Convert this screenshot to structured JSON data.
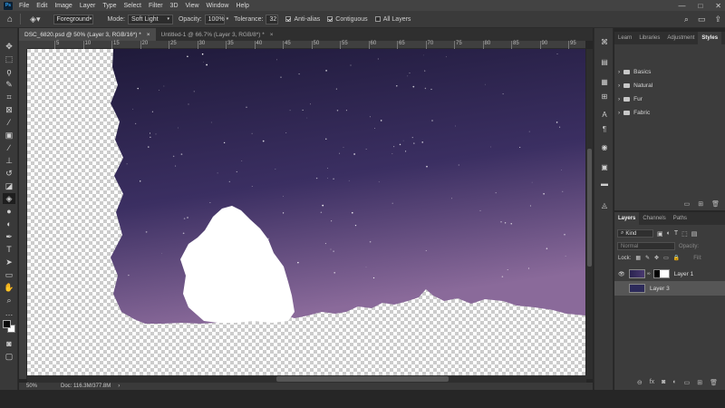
{
  "app": {
    "logo_text": "Ps"
  },
  "menu": [
    "File",
    "Edit",
    "Image",
    "Layer",
    "Type",
    "Select",
    "Filter",
    "3D",
    "View",
    "Window",
    "Help"
  ],
  "window_controls": [
    "—",
    "□",
    "✕"
  ],
  "options": {
    "fill_source": "Foreground",
    "mode_label": "Mode:",
    "mode_value": "Soft Light",
    "opacity_label": "Opacity:",
    "opacity_value": "100%",
    "tolerance_label": "Tolerance:",
    "tolerance_value": "32",
    "anti_alias": "Anti-alias",
    "contiguous": "Contiguous",
    "all_layers": "All Layers"
  },
  "tabs": [
    {
      "label": "DSC_6820.psd @ 50% (Layer 3, RGB/16*) *",
      "close": "×"
    },
    {
      "label": "Untitled-1 @ 66.7% (Layer 3, RGB/8*) *",
      "close": "×"
    }
  ],
  "ruler": {
    "top_labels": [
      "5",
      "10",
      "15",
      "20",
      "25",
      "30",
      "35",
      "40",
      "45",
      "50",
      "55",
      "60",
      "65",
      "70",
      "75",
      "80",
      "85",
      "90",
      "95"
    ]
  },
  "status": {
    "zoom": "50%",
    "doc": "Doc: 116.3M/377.8M"
  },
  "styles_panel": {
    "tabs": [
      "Learn",
      "Libraries",
      "Adjustment",
      "Styles"
    ],
    "active_tab": "Styles",
    "folders": [
      "Basics",
      "Natural",
      "Fur",
      "Fabric"
    ]
  },
  "layers_panel": {
    "tabs": [
      "Layers",
      "Channels",
      "Paths"
    ],
    "kind_label": "Kind",
    "blend_mode": "Normal",
    "opacity_label": "Opacity:",
    "lock_label": "Lock:",
    "fill_label": "Fill:",
    "layers": [
      {
        "name": "Layer 1",
        "visible": true,
        "selected": false
      },
      {
        "name": "Layer 3",
        "visible": false,
        "selected": true
      }
    ]
  },
  "colors": {
    "sky_top": "#1f1a3a",
    "sky_mid": "#3b2f62",
    "sky_horizon": "#8a6a9a",
    "fg": "#000000",
    "bg": "#ffffff"
  }
}
